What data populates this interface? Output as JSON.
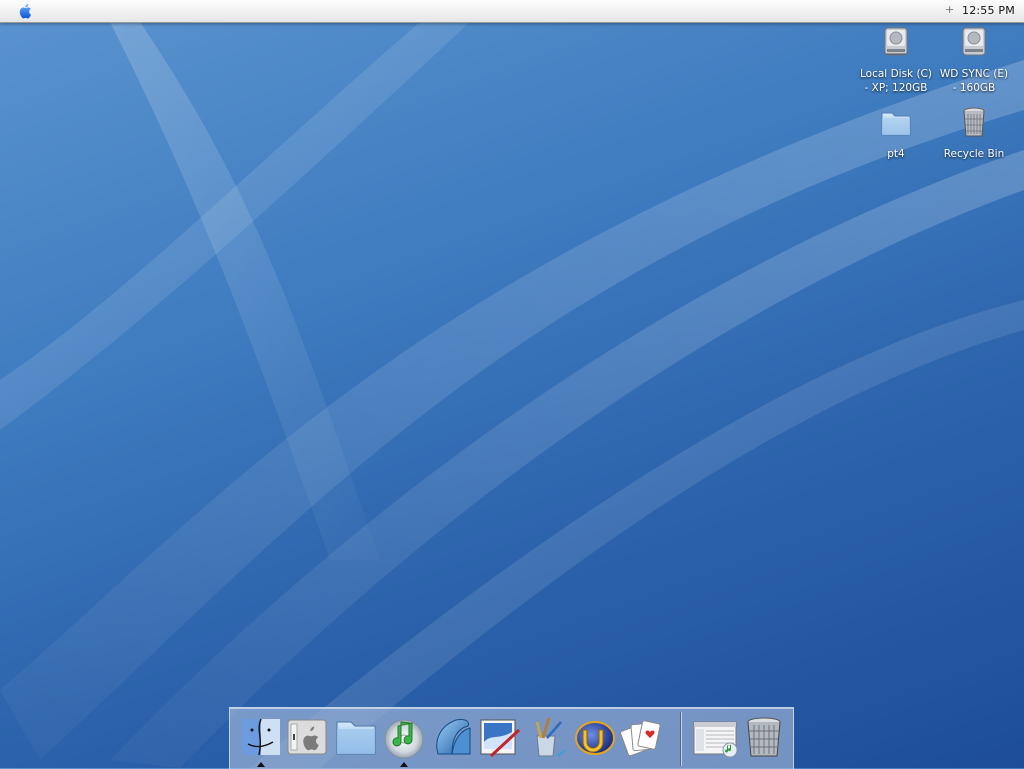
{
  "menubar": {
    "apple_icon": "apple-logo-icon",
    "extra_icon": "+",
    "clock": "12:55 PM"
  },
  "desktop_icons": [
    {
      "label": "Local Disk (C) - XP; 120GB",
      "line1": "Local Disk (C)",
      "line2": "- XP; 120GB",
      "icon": "hard-drive-icon"
    },
    {
      "label": "WD SYNC (E) - 160GB",
      "line1": "WD SYNC (E)",
      "line2": "- 160GB",
      "icon": "hard-drive-icon"
    },
    {
      "label": "pt4",
      "line1": "pt4",
      "icon": "folder-icon"
    },
    {
      "label": "Recycle Bin",
      "line1": "Recycle Bin",
      "icon": "trash-icon"
    }
  ],
  "dock": {
    "items": [
      {
        "name": "Finder",
        "icon": "finder-icon",
        "running": true
      },
      {
        "name": "System Preferences",
        "icon": "apple-panel-icon",
        "running": false
      },
      {
        "name": "Folder",
        "icon": "folder-icon",
        "running": false
      },
      {
        "name": "iTunes",
        "icon": "itunes-icon",
        "running": true
      },
      {
        "name": "Application",
        "icon": "blue-shell-icon",
        "running": false
      },
      {
        "name": "Picture Editor",
        "icon": "picture-editor-icon",
        "running": false
      },
      {
        "name": "Paint Tools",
        "icon": "brushes-icon",
        "running": false
      },
      {
        "name": "Unreal Tournament",
        "icon": "unreal-icon",
        "running": false
      },
      {
        "name": "Solitaire",
        "icon": "cards-icon",
        "running": false
      }
    ],
    "right_items": [
      {
        "name": "Music Window",
        "icon": "music-window-icon"
      },
      {
        "name": "Trash",
        "icon": "trash-icon"
      }
    ]
  },
  "colors": {
    "wallpaper_top": "#5b94cf",
    "wallpaper_bottom": "#1d4d99",
    "menubar": "#f2f2f2"
  }
}
